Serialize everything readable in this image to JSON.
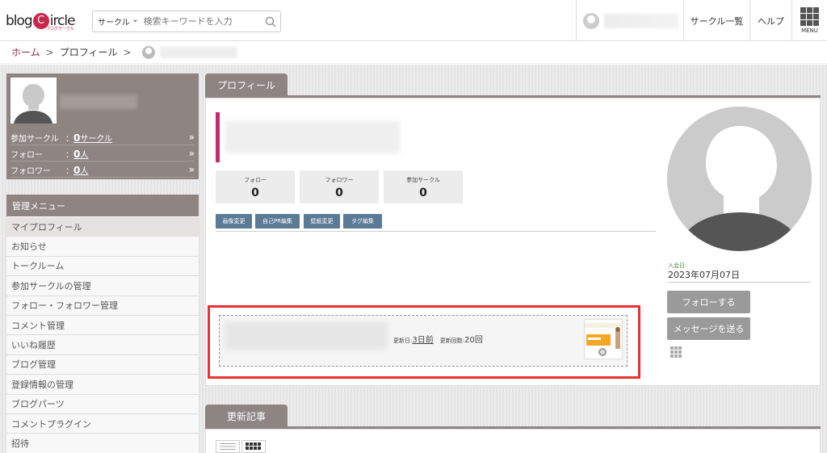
{
  "header": {
    "logo_text_a": "blog",
    "logo_text_q": "C",
    "logo_text_b": "ircle",
    "logo_sub": "ブログサークル",
    "search_category": "サークル",
    "search_placeholder": "検索キーワードを入力",
    "circle_list": "サークル一覧",
    "help": "ヘルプ",
    "menu": "MENU"
  },
  "breadcrumb": {
    "home": "ホーム",
    "separator": ">",
    "profile": "プロフィール"
  },
  "user_card": {
    "rows": [
      {
        "label": "参加サークル",
        "colon": "：",
        "count": "0",
        "unit": "サークル",
        "arrow": "»"
      },
      {
        "label": "フォロー",
        "colon": "：",
        "count": "0",
        "unit": "人",
        "arrow": "»"
      },
      {
        "label": "フォロワー",
        "colon": "：",
        "count": "0",
        "unit": "人",
        "arrow": "»"
      }
    ]
  },
  "menu": {
    "title": "管理メニュー",
    "items": [
      "マイプロフィール",
      "お知らせ",
      "トークルーム",
      "参加サークルの管理",
      "フォロー・フォロワー管理",
      "コメント管理",
      "いいね履歴",
      "ブログ管理",
      "登録情報の管理",
      "ブログパーツ",
      "コメントプラグイン",
      "招待"
    ]
  },
  "profile": {
    "tab": "プロフィール",
    "stats": [
      {
        "label": "フォロー",
        "value": "0"
      },
      {
        "label": "フォロワー",
        "value": "0"
      },
      {
        "label": "参加サークル",
        "value": "0"
      }
    ],
    "buttons": [
      "画像変更",
      "自己PR編集",
      "壁紙変更",
      "タグ編集"
    ],
    "join_label": "入会日:",
    "join_date": "2023年07月07日",
    "follow_button": "フォローする",
    "message_button": "メッセージを送る",
    "blog": {
      "updated_label": "更新日:",
      "updated_value": "3日前",
      "count_label": "更新回数:",
      "count_value": "20回"
    }
  },
  "recent": {
    "tab": "更新記事"
  },
  "colors": {
    "brand": "#8e8482",
    "accent": "#c8286e",
    "highlight": "#e83030",
    "edit_button": "#5a7a96"
  }
}
